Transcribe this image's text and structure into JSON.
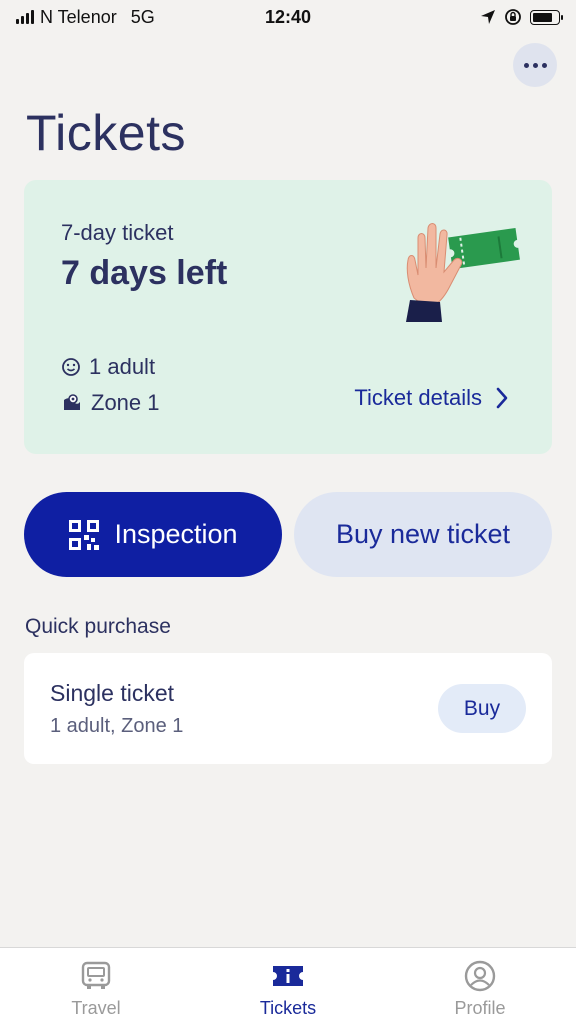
{
  "status_bar": {
    "carrier": "N Telenor",
    "network": "5G",
    "time": "12:40",
    "battery_level": 0.8
  },
  "header": {
    "more_icon": "more-horizontal-icon",
    "title": "Tickets"
  },
  "ticket_card": {
    "type": "7-day ticket",
    "days_left": "7 days left",
    "travellers": "1 adult",
    "zone": "Zone 1",
    "details_link": "Ticket details",
    "background_color": "#dff2e8"
  },
  "actions": {
    "inspection_label": "Inspection",
    "buy_new_label": "Buy new ticket",
    "inspection_color": "#0f1fa3"
  },
  "quick_purchase": {
    "section_label": "Quick purchase",
    "item_title": "Single ticket",
    "item_subtitle": "1 adult, Zone 1",
    "buy_label": "Buy"
  },
  "tab_bar": {
    "tabs": [
      {
        "label": "Travel",
        "icon": "bus-icon",
        "active": false
      },
      {
        "label": "Tickets",
        "icon": "ticket-icon",
        "active": true
      },
      {
        "label": "Profile",
        "icon": "profile-icon",
        "active": false
      }
    ],
    "active_color": "#1a2a9a"
  }
}
